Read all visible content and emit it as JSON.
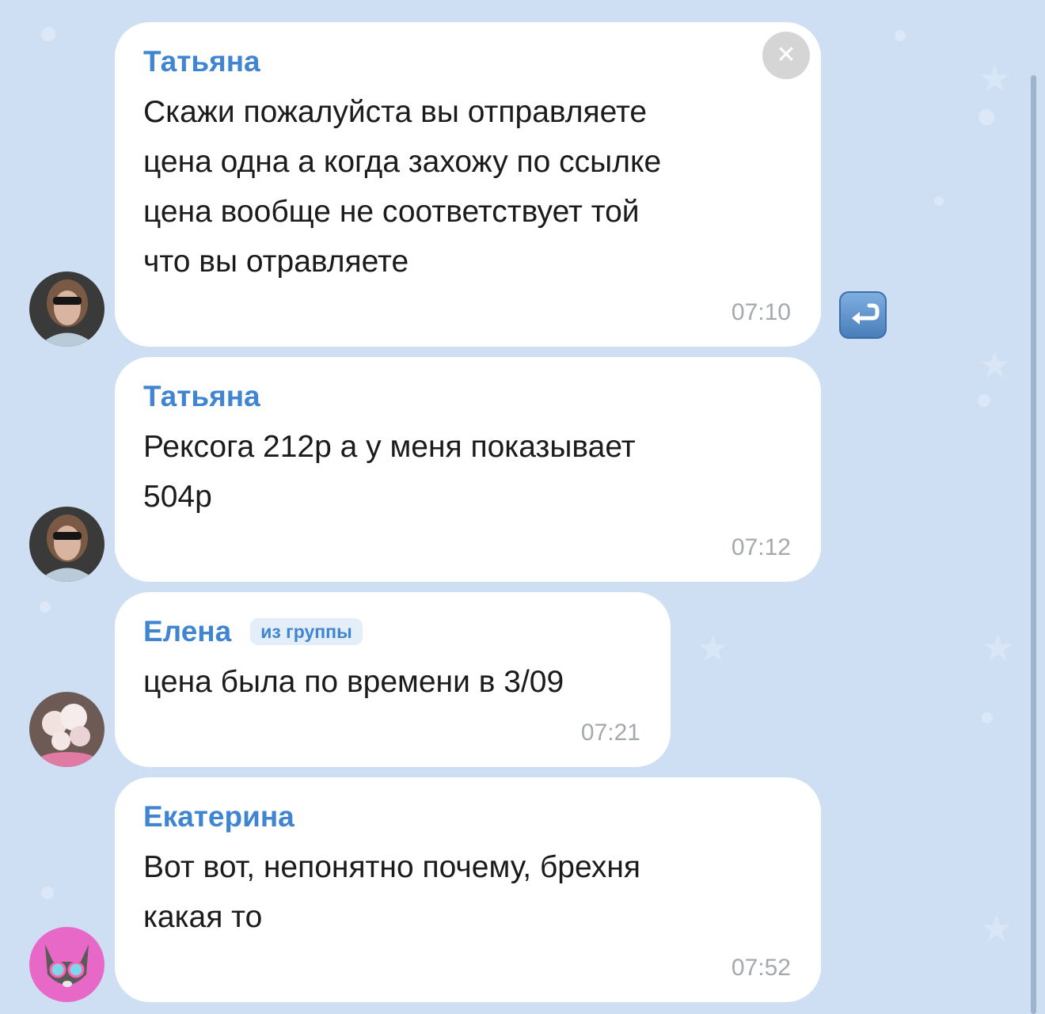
{
  "messages": [
    {
      "sender": "Татьяна",
      "text": "Скажи пожалуйста вы отправляете\nцена одна а когда захожу по ссылке\nцена вообще не соответствует той\nчто вы отравляете",
      "time": "07:10"
    },
    {
      "sender": "Татьяна",
      "text": "Рексога 212р а у меня показывает\n504р",
      "time": "07:12"
    },
    {
      "sender": "Елена",
      "tag": "из группы",
      "text": "цена была по времени в 3/09",
      "time": "07:21"
    },
    {
      "sender": "Екатерина",
      "text": "Вот вот, непонятно почему, брехня\nкакая то",
      "time": "07:52"
    }
  ],
  "icons": {
    "close": "close-icon",
    "reply": "reply-icon"
  },
  "colors": {
    "background": "#cfdff3",
    "bubble": "#ffffff",
    "sender_name": "#3f85d1",
    "timestamp": "#a4a9ae"
  }
}
